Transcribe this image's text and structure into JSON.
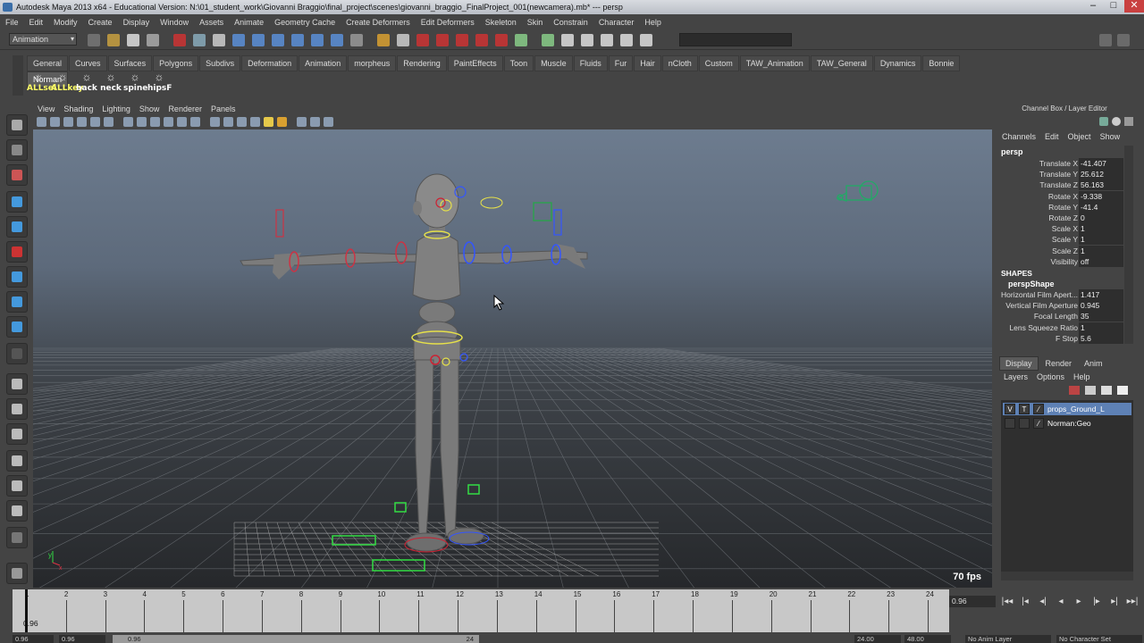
{
  "window": {
    "title": "Autodesk Maya 2013 x64 - Educational Version: N:\\01_student_work\\Giovanni Braggio\\final_project\\scenes\\giovanni_braggio_FinalProject_001(newcamera).mb*   ---   persp",
    "controls": [
      "–",
      "□",
      "✕"
    ]
  },
  "menubar": [
    "File",
    "Edit",
    "Modify",
    "Create",
    "Display",
    "Window",
    "Assets",
    "Animate",
    "Geometry Cache",
    "Create Deformers",
    "Edit Deformers",
    "Skeleton",
    "Skin",
    "Constrain",
    "Character",
    "Help"
  ],
  "status_line": {
    "mode": "Animation"
  },
  "shelf": {
    "tabs": [
      "General",
      "Curves",
      "Surfaces",
      "Polygons",
      "Subdivs",
      "Deformation",
      "Animation",
      "morpheus",
      "Rendering",
      "PaintEffects",
      "Toon",
      "Muscle",
      "Fluids",
      "Fur",
      "Hair",
      "nCloth",
      "Custom",
      "TAW_Animation",
      "TAW_General",
      "Dynamics",
      "Bonnie",
      "Norman"
    ],
    "active_tab": "Norman",
    "buttons": [
      "ALLsel",
      "ALLkey",
      "back",
      "neck",
      "spine",
      "hipsF"
    ]
  },
  "viewport": {
    "menu": [
      "View",
      "Shading",
      "Lighting",
      "Show",
      "Renderer",
      "Panels"
    ],
    "fps": "70 fps",
    "axis_y": "y",
    "axis_x": "x"
  },
  "channel_box": {
    "title": "Channel Box / Layer Editor",
    "menu": [
      "Channels",
      "Edit",
      "Object",
      "Show"
    ],
    "object": "persp",
    "channels": [
      {
        "label": "Translate X",
        "value": "-41.407"
      },
      {
        "label": "Translate Y",
        "value": "25.612"
      },
      {
        "label": "Translate Z",
        "value": "56.163"
      },
      {
        "label": "Rotate X",
        "value": "-9.338"
      },
      {
        "label": "Rotate Y",
        "value": "-41.4"
      },
      {
        "label": "Rotate Z",
        "value": "0"
      },
      {
        "label": "Scale X",
        "value": "1"
      },
      {
        "label": "Scale Y",
        "value": "1"
      },
      {
        "label": "Scale Z",
        "value": "1"
      },
      {
        "label": "Visibility",
        "value": "off"
      }
    ],
    "shapes_header": "SHAPES",
    "shape_name": "perspShape",
    "shape_channels": [
      {
        "label": "Horizontal Film Apert...",
        "value": "1.417"
      },
      {
        "label": "Vertical Film Aperture",
        "value": "0.945"
      },
      {
        "label": "Focal Length",
        "value": "35"
      },
      {
        "label": "Lens Squeeze Ratio",
        "value": "1"
      },
      {
        "label": "F Stop",
        "value": "5.6"
      }
    ]
  },
  "layer_editor": {
    "tabs": [
      "Display",
      "Render",
      "Anim"
    ],
    "active_tab": "Display",
    "menu": [
      "Layers",
      "Options",
      "Help"
    ],
    "layers": [
      {
        "v": "V",
        "t": "T",
        "name": "props_Ground_L",
        "selected": true
      },
      {
        "v": "",
        "t": "",
        "name": "Norman:Geo",
        "selected": false
      }
    ]
  },
  "time_slider": {
    "ticks": [
      "1",
      "2",
      "3",
      "4",
      "5",
      "6",
      "7",
      "8",
      "9",
      "10",
      "11",
      "12",
      "13",
      "14",
      "15",
      "16",
      "17",
      "18",
      "19",
      "20",
      "21",
      "22",
      "23",
      "24"
    ],
    "current_frame": "0.96",
    "frame_field": "0.96"
  },
  "range_slider": {
    "start": "0.96",
    "anim_start": "0.96",
    "range_start": "0.96",
    "range_end": "24",
    "anim_end": "24.00",
    "end": "48.00",
    "anim_layer": "No Anim Layer",
    "character_set": "No Character Set"
  },
  "playback": [
    "|◂◂",
    "|◂",
    "◂|",
    "◂",
    "▸",
    "|▸",
    "▸|",
    "▸▸|"
  ]
}
